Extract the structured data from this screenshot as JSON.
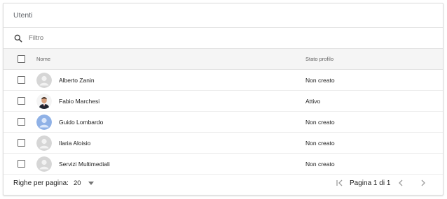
{
  "panel": {
    "title": "Utenti"
  },
  "filter": {
    "placeholder": "Filtro",
    "icon": "search-icon"
  },
  "table": {
    "columns": {
      "name": "Nome",
      "status": "Stato profilo"
    },
    "rows": [
      {
        "name": "Alberto Zanin",
        "status": "Non creato",
        "avatar": "default-grey"
      },
      {
        "name": "Fabio Marchesi",
        "status": "Attivo",
        "avatar": "photo"
      },
      {
        "name": "Guido Lombardo",
        "status": "Non creato",
        "avatar": "default-blue"
      },
      {
        "name": "Ilaria Aloisio",
        "status": "Non creato",
        "avatar": "default-grey"
      },
      {
        "name": "Servizi Multimediali",
        "status": "Non creato",
        "avatar": "default-grey"
      }
    ]
  },
  "footer": {
    "rows_per_page_label": "Righe per pagina:",
    "rows_per_page_value": "20",
    "page_label": "Pagina 1 di 1"
  },
  "colors": {
    "border": "#e3e3e3",
    "header_bg": "#f5f5f5",
    "avatar_grey": "#d6d6d6",
    "avatar_blue": "#8fb1e6",
    "disabled_icon": "#9e9e9e"
  }
}
